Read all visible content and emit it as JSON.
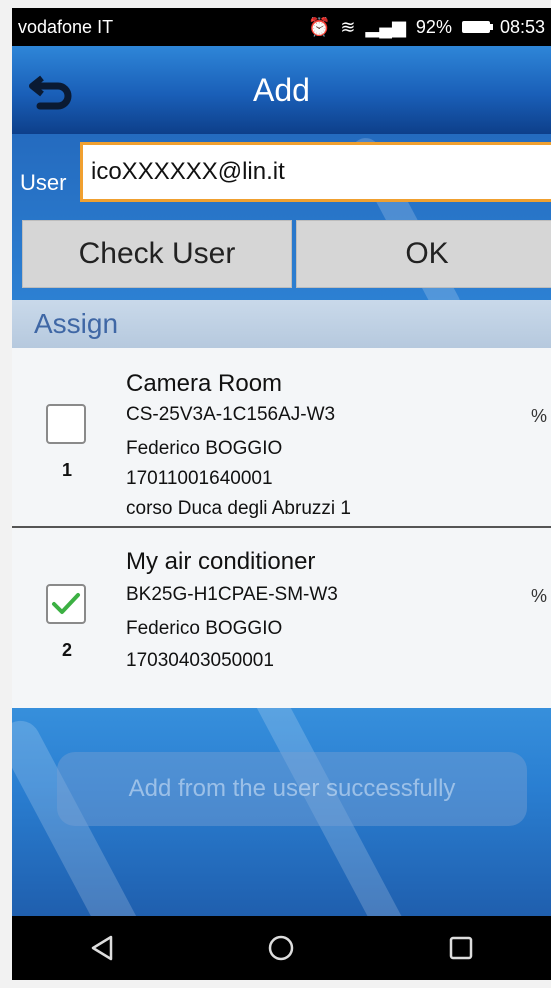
{
  "status_bar": {
    "carrier": "vodafone IT",
    "signal_text": "92%",
    "time": "08:53"
  },
  "header": {
    "title": "Add"
  },
  "user_field": {
    "label": "User",
    "value": "icoXXXXXX@lin.it"
  },
  "buttons": {
    "check_user": "Check User",
    "ok": "OK"
  },
  "assign": {
    "label": "Assign"
  },
  "devices": [
    {
      "index": "1",
      "name": "Camera Room",
      "model": "CS-25V3A-1C156AJ-W3",
      "owner": "Federico BOGGIO",
      "serial": "17011001640001",
      "address": "corso Duca degli Abruzzi 1",
      "percent": "%",
      "checked": false
    },
    {
      "index": "2",
      "name": "My air conditioner",
      "model": "BK25G-H1CPAE-SM-W3",
      "owner": "Federico BOGGIO",
      "serial": "17030403050001",
      "percent": "%",
      "checked": true
    }
  ],
  "toast": {
    "message": "Add from the user successfully"
  },
  "colors": {
    "accent_orange": "#f0a030",
    "header_blue": "#1a5fb8",
    "check_green": "#3cb043"
  }
}
